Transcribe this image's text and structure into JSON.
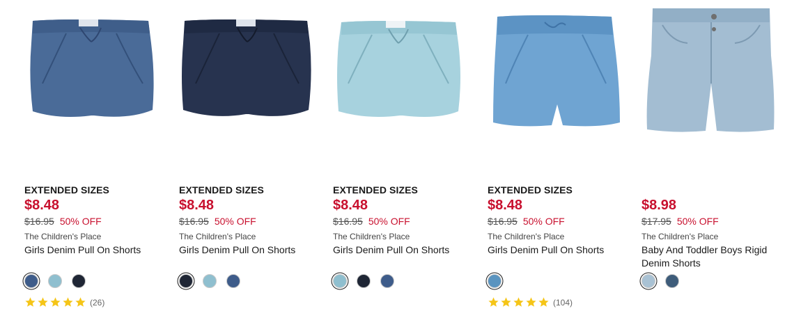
{
  "products": [
    {
      "badge": "EXTENDED SIZES",
      "price": "$8.48",
      "was": "$16.95",
      "off": "50% OFF",
      "brand": "The Children's Place",
      "name": "Girls Denim Pull On Shorts",
      "image": "dark-chambray-shorts",
      "swatches": [
        {
          "color": "#3e5c8a",
          "selected": true
        },
        {
          "color": "#8fbfcf",
          "selected": false
        },
        {
          "color": "#1f2635",
          "selected": false
        }
      ],
      "rating": {
        "stars": 5,
        "count": "(26)"
      }
    },
    {
      "badge": "EXTENDED SIZES",
      "price": "$8.48",
      "was": "$16.95",
      "off": "50% OFF",
      "brand": "The Children's Place",
      "name": "Girls Denim Pull On Shorts",
      "image": "navy-shorts",
      "swatches": [
        {
          "color": "#1f2635",
          "selected": true
        },
        {
          "color": "#8fbfcf",
          "selected": false
        },
        {
          "color": "#3e5c8a",
          "selected": false
        }
      ],
      "rating": null
    },
    {
      "badge": "EXTENDED SIZES",
      "price": "$8.48",
      "was": "$16.95",
      "off": "50% OFF",
      "brand": "The Children's Place",
      "name": "Girls Denim Pull On Shorts",
      "image": "light-chambray-shorts",
      "swatches": [
        {
          "color": "#8fbfcf",
          "selected": true
        },
        {
          "color": "#1f2635",
          "selected": false
        },
        {
          "color": "#3e5c8a",
          "selected": false
        }
      ],
      "rating": null
    },
    {
      "badge": "EXTENDED SIZES",
      "price": "$8.48",
      "was": "$16.95",
      "off": "50% OFF",
      "brand": "The Children's Place",
      "name": "Girls Denim Pull On Shorts",
      "image": "medium-blue-shorts",
      "swatches": [
        {
          "color": "#5a94c0",
          "selected": true
        }
      ],
      "rating": {
        "stars": 5,
        "count": "(104)"
      }
    },
    {
      "badge": "",
      "price": "$8.98",
      "was": "$17.95",
      "off": "50% OFF",
      "brand": "The Children's Place",
      "name": "Baby And Toddler Boys Rigid Denim Shorts",
      "image": "boys-denim-shorts",
      "swatches": [
        {
          "color": "#a9c2d4",
          "selected": true
        },
        {
          "color": "#3e5c7a",
          "selected": false
        }
      ],
      "rating": null
    }
  ],
  "colors": {
    "price_red": "#c8102e",
    "star_gold": "#f5c518"
  }
}
